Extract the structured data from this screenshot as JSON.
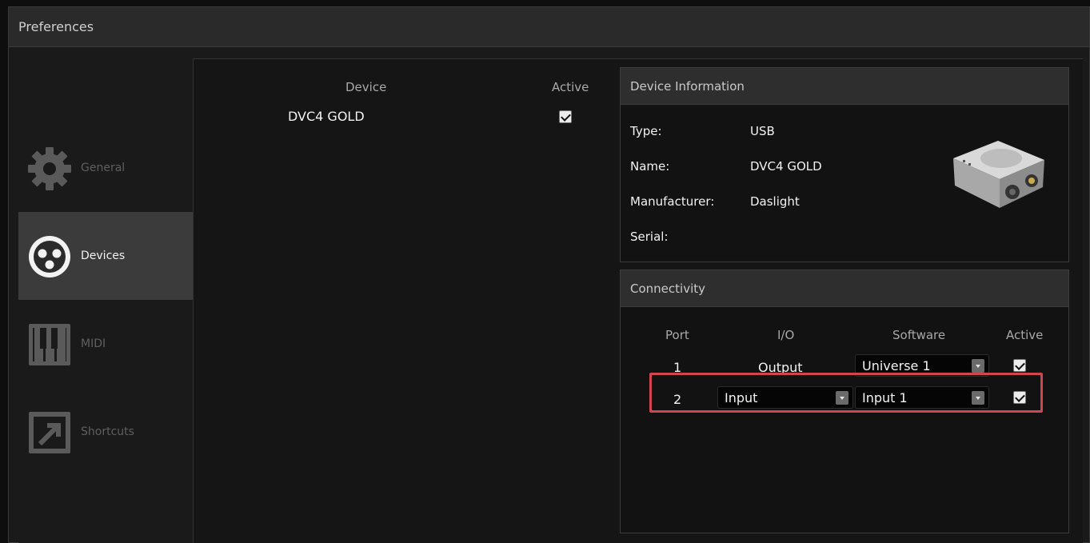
{
  "window": {
    "title": "Preferences"
  },
  "sidebar": {
    "items": [
      {
        "label": "General",
        "icon": "gear-icon",
        "active": false
      },
      {
        "label": "Devices",
        "icon": "xlr-connector-icon",
        "active": true
      },
      {
        "label": "MIDI",
        "icon": "piano-keys-icon",
        "active": false
      },
      {
        "label": "Shortcuts",
        "icon": "shortcut-arrow-icon",
        "active": false
      }
    ]
  },
  "devices": {
    "headers": {
      "device": "Device",
      "active": "Active"
    },
    "rows": [
      {
        "name": "DVC4 GOLD",
        "active": true
      }
    ]
  },
  "device_info": {
    "title": "Device Information",
    "fields": [
      {
        "key": "Type:",
        "value": "USB"
      },
      {
        "key": "Name:",
        "value": "DVC4 GOLD"
      },
      {
        "key": "Manufacturer:",
        "value": "Daslight"
      },
      {
        "key": "Serial:",
        "value": ""
      }
    ],
    "image_icon": "usb-dmx-interface-image"
  },
  "connectivity": {
    "title": "Connectivity",
    "headers": {
      "port": "Port",
      "io": "I/O",
      "software": "Software",
      "active": "Active"
    },
    "rows": [
      {
        "port": "1",
        "io": "Output",
        "io_dropdown": false,
        "software": "Universe 1",
        "active": true
      },
      {
        "port": "2",
        "io": "Input",
        "io_dropdown": true,
        "software": "Input 1",
        "active": true
      }
    ]
  },
  "colors": {
    "highlight": "#d1454f",
    "active_sidebar": "#3b3b3b"
  }
}
